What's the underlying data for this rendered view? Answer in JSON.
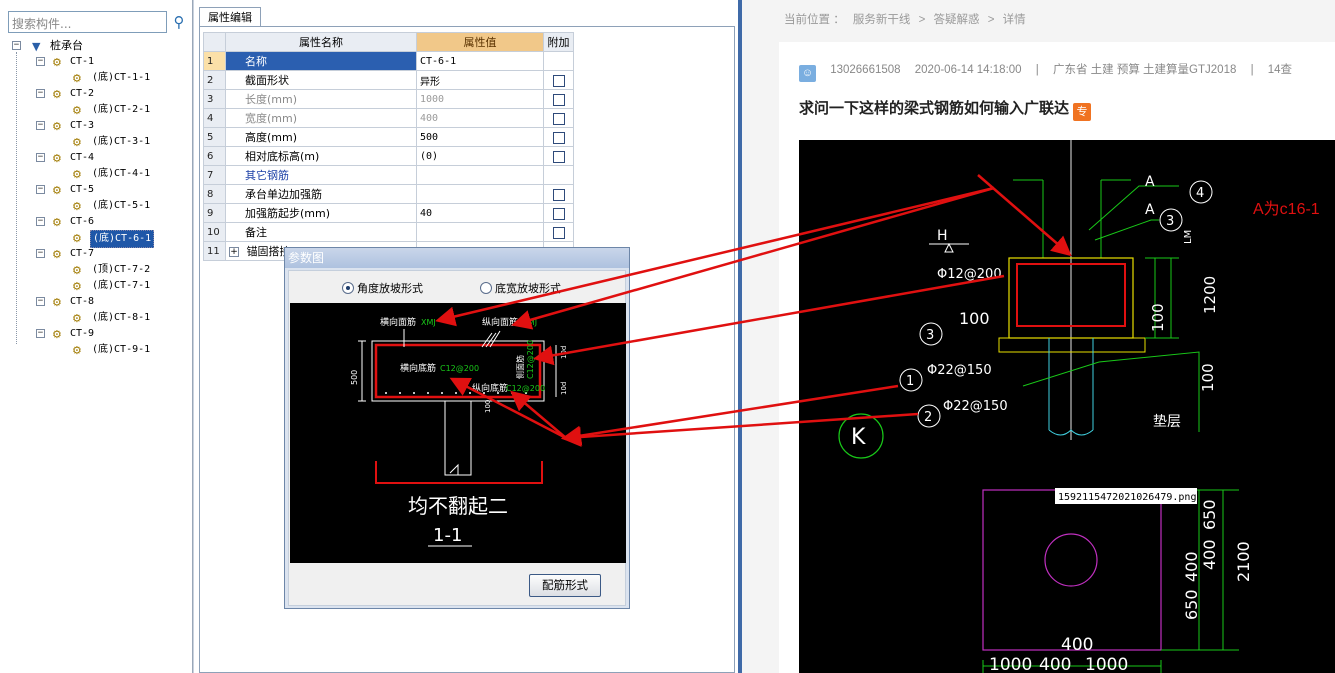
{
  "tree": {
    "search_placeholder": "搜索构件...",
    "root_label": "桩承台",
    "items": [
      {
        "label": "CT-1",
        "child": "(底)CT-1-1"
      },
      {
        "label": "CT-2",
        "child": "(底)CT-2-1"
      },
      {
        "label": "CT-3",
        "child": "(底)CT-3-1"
      },
      {
        "label": "CT-4",
        "child": "(底)CT-4-1"
      },
      {
        "label": "CT-5",
        "child": "(底)CT-5-1"
      },
      {
        "label": "CT-6",
        "child": "(底)CT-6-1"
      },
      {
        "label": "CT-7",
        "child": "(顶)CT-7-2",
        "child2": "(底)CT-7-1"
      },
      {
        "label": "CT-8",
        "child": "(底)CT-8-1"
      },
      {
        "label": "CT-9",
        "child": "(底)CT-9-1"
      }
    ]
  },
  "props": {
    "tab_label": "属性编辑",
    "col_name": "属性名称",
    "col_value": "属性值",
    "col_extra": "附加",
    "rows": [
      {
        "num": "1",
        "name": "名称",
        "value": "CT-6-1"
      },
      {
        "num": "2",
        "name": "截面形状",
        "value": "异形"
      },
      {
        "num": "3",
        "name": "长度(mm)",
        "value": "1000"
      },
      {
        "num": "4",
        "name": "宽度(mm)",
        "value": "400"
      },
      {
        "num": "5",
        "name": "高度(mm)",
        "value": "500"
      },
      {
        "num": "6",
        "name": "相对底标高(m)",
        "value": "(0)"
      },
      {
        "num": "7",
        "name": "其它钢筋",
        "value": ""
      },
      {
        "num": "8",
        "name": "承台单边加强筋",
        "value": ""
      },
      {
        "num": "9",
        "name": "加强筋起步(mm)",
        "value": "40"
      },
      {
        "num": "10",
        "name": "备注",
        "value": ""
      },
      {
        "num": "11",
        "name": "锚固搭接",
        "value": ""
      }
    ],
    "expand_symbol": "+"
  },
  "dialog": {
    "title": "参数图",
    "radio_angle": "角度放坡形式",
    "radio_width": "底宽放坡形式",
    "rebar_button": "配筋形式",
    "canvas": {
      "top_h_bar": "横向面筋",
      "top_h_bar_code": "XMJ",
      "top_v_bar": "纵向面筋",
      "top_v_bar_code": "YMJ",
      "bottom_h_bar": "横向底筋",
      "bottom_h_bar_code": "C12@200",
      "bottom_v_bar": "纵向底筋",
      "bottom_v_bar_code": "C12@200",
      "side_bar": "侧面筋",
      "side_bar_code": "C12@200",
      "dim_height": "500",
      "dim_10d_a": "10d",
      "dim_10d_b": "10d",
      "dim_100": "100",
      "caption": "均不翻起二",
      "section": "1-1"
    }
  },
  "web": {
    "breadcrumb": [
      "当前位置 ：",
      "服务新干线",
      ">",
      "答疑解惑",
      ">",
      "详情"
    ],
    "user": "13026661508",
    "datetime": "2020-06-14 14:18:00",
    "sep": "|",
    "tags": "广东省  土建  预算  土建算量GTJ2018",
    "views": "14查",
    "title": "求问一下这样的梁式钢筋如何输入广联达",
    "badge": "专",
    "cad": {
      "note": "A为c16-1",
      "label_A1": "A",
      "label_A2": "A",
      "circle_4": "4",
      "circle_3a": "3",
      "circle_3b": "3",
      "circle_1": "1",
      "circle_2": "2",
      "circle_K": "K",
      "rebar_1": "Φ12@200",
      "rebar_2": "Φ22@150",
      "rebar_3": "Φ22@150",
      "dim_100a": "100",
      "dim_100b": "100",
      "dim_100c": "100",
      "dim_1200": "1200",
      "label_H": "H",
      "label_lm": "LM",
      "label_cushion": "垫层",
      "file_name": "1592115472021026479.png",
      "dim_650a": "650",
      "dim_650b": "650",
      "dim_400a": "400",
      "dim_400b": "400",
      "dim_400c": "400",
      "dim_2100": "2100",
      "dim_1000a": "1000",
      "dim_1000b": "1000",
      "dim_400d": "400"
    }
  },
  "colors": {
    "arrow_red": "#e01010",
    "cad_green": "#19c819",
    "cad_yellow": "#e8e000",
    "cad_magenta": "#c030c0",
    "cad_cyan": "#40d0e0",
    "selection_blue": "#2b5fb0"
  }
}
